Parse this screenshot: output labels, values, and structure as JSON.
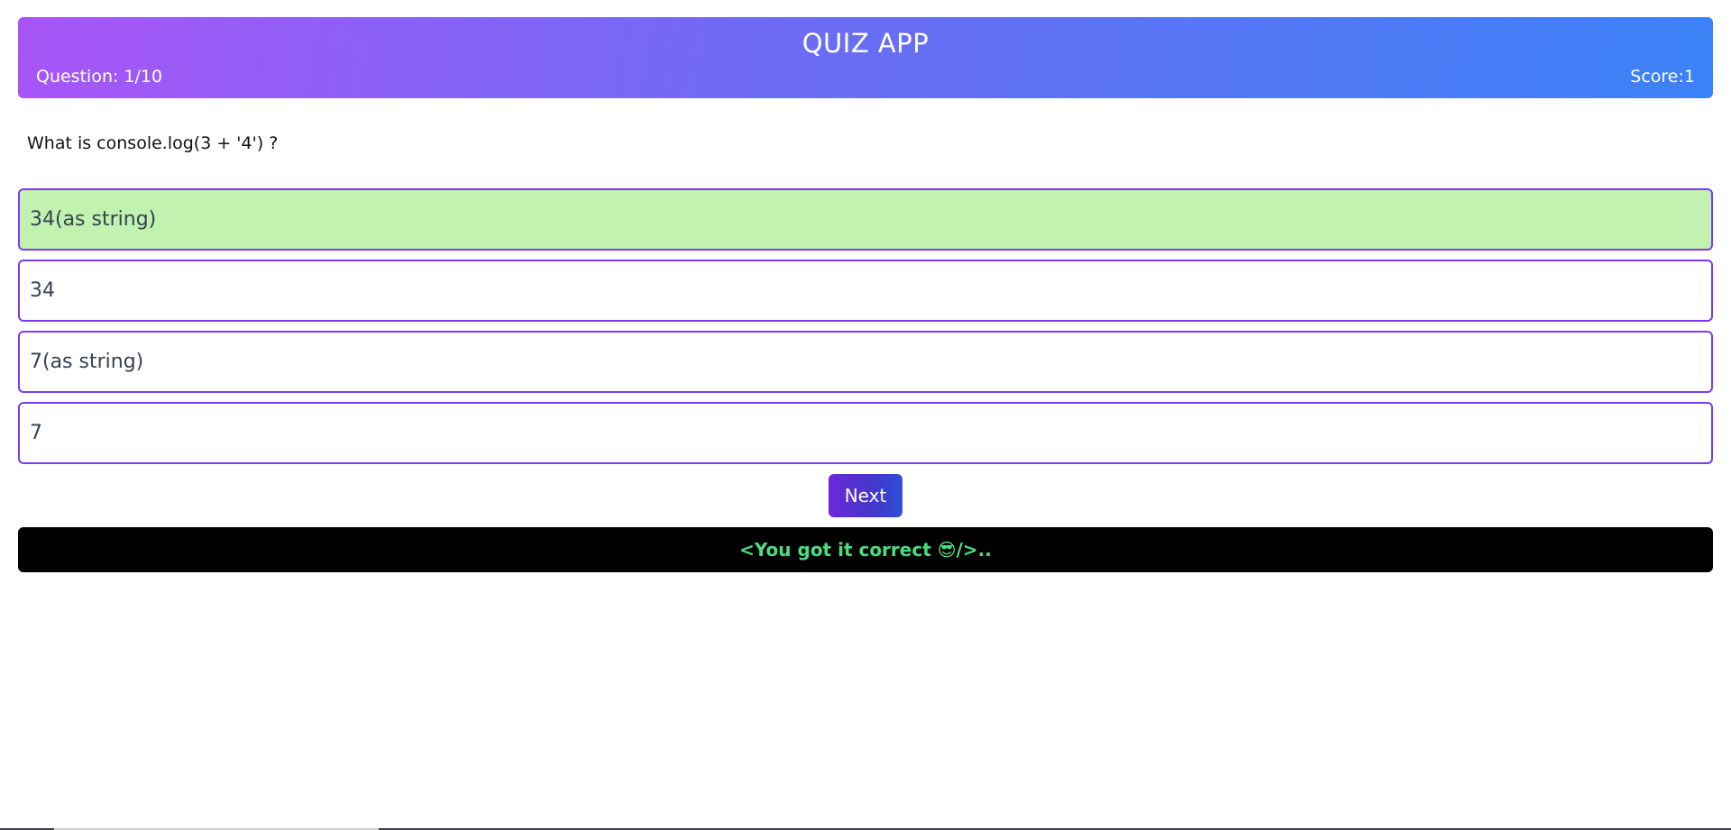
{
  "header": {
    "title": "QUIZ APP",
    "question_counter": "Question: 1/10",
    "score": "Score:1"
  },
  "question": {
    "text": "What is console.log(3 + '4') ?"
  },
  "options": [
    {
      "label": "34(as string)",
      "state": "correct"
    },
    {
      "label": "34",
      "state": "default"
    },
    {
      "label": "7(as string)",
      "state": "default"
    },
    {
      "label": "7",
      "state": "default"
    }
  ],
  "actions": {
    "next_label": "Next"
  },
  "feedback": {
    "message": "<You got it correct 😎/>.."
  },
  "colors": {
    "header_gradient_start": "#a855f7",
    "header_gradient_end": "#3b82f6",
    "option_border": "#7e3af2",
    "correct_option_bg": "#c1f2b0",
    "feedback_bg": "#000000",
    "feedback_text": "#4ade80"
  }
}
